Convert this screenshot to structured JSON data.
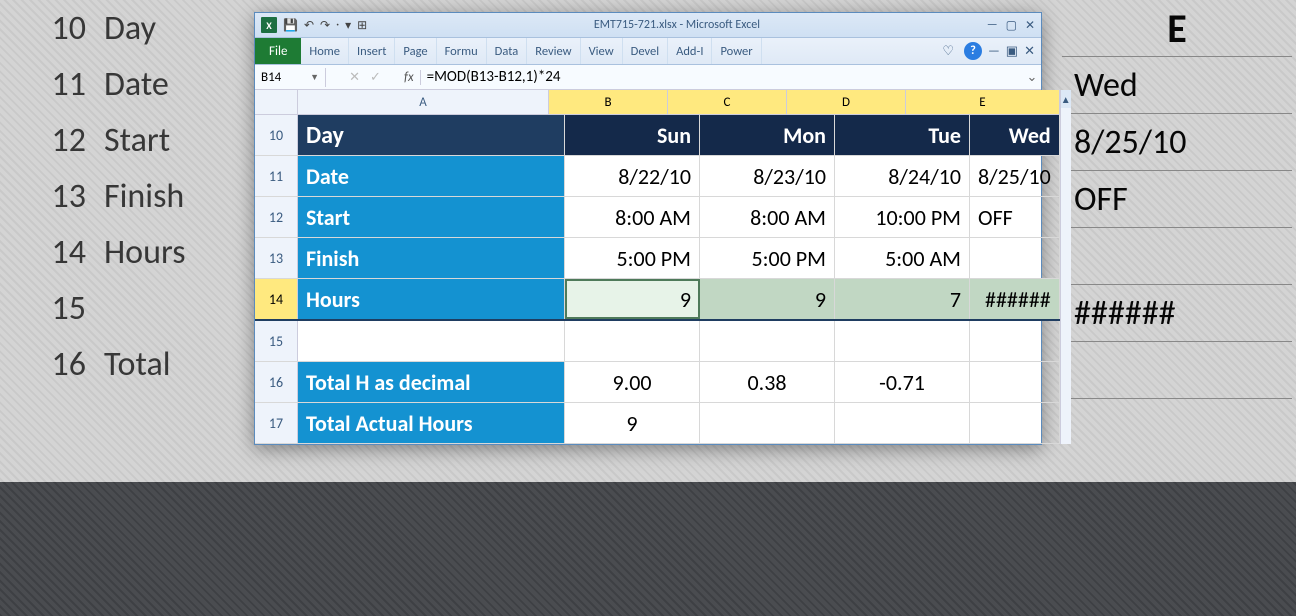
{
  "bg": {
    "col_e_header": "E",
    "rows": [
      {
        "n": "10",
        "label": "Day",
        "e": "Wed"
      },
      {
        "n": "11",
        "label": "Date",
        "e": "8/25/10"
      },
      {
        "n": "12",
        "label": "Start",
        "e": "OFF"
      },
      {
        "n": "13",
        "label": "Finish",
        "e": ""
      },
      {
        "n": "14",
        "label": "Hours",
        "e": "######"
      },
      {
        "n": "15",
        "label": "",
        "e": ""
      },
      {
        "n": "16",
        "label": "Total",
        "e": ""
      }
    ]
  },
  "titlebar": {
    "caption": "EMT715-721.xlsx - Microsoft Excel",
    "logo": "X"
  },
  "ribbon": {
    "file": "File",
    "tabs": [
      "Home",
      "Insert",
      "Page",
      "Formu",
      "Data",
      "Review",
      "View",
      "Devel",
      "Add-I",
      "Power"
    ]
  },
  "namebox": "B14",
  "formula": "=MOD(B13-B12,1)*24",
  "columns": {
    "A": "A",
    "B": "B",
    "C": "C",
    "D": "D",
    "E": "E"
  },
  "rows": [
    {
      "n": "10",
      "A": "Day",
      "B": "Sun",
      "C": "Mon",
      "D": "Tue",
      "E": "Wed",
      "hdr": true
    },
    {
      "n": "11",
      "A": "Date",
      "B": "8/22/10",
      "C": "8/23/10",
      "D": "8/24/10",
      "E": "8/25/10",
      "blue": true
    },
    {
      "n": "12",
      "A": "Start",
      "B": "8:00 AM",
      "C": "8:00 AM",
      "D": "10:00 PM",
      "E": "OFF",
      "blue": true,
      "Eleft": true
    },
    {
      "n": "13",
      "A": "Finish",
      "B": "5:00 PM",
      "C": "5:00 PM",
      "D": "5:00 AM",
      "E": "",
      "blue": true
    },
    {
      "n": "14",
      "A": "Hours",
      "B": "9",
      "C": "9",
      "D": "7",
      "E": "######",
      "blue": true,
      "sel": true
    },
    {
      "n": "15",
      "A": "",
      "B": "",
      "C": "",
      "D": "",
      "E": ""
    },
    {
      "n": "16",
      "A": "Total H as decimal",
      "B": "9.00",
      "C": "0.38",
      "D": "-0.71",
      "E": "",
      "blue": true,
      "center": true
    },
    {
      "n": "17",
      "A": "Total Actual Hours",
      "B": "9",
      "C": "",
      "D": "",
      "E": "",
      "blue": true,
      "center": true
    }
  ]
}
